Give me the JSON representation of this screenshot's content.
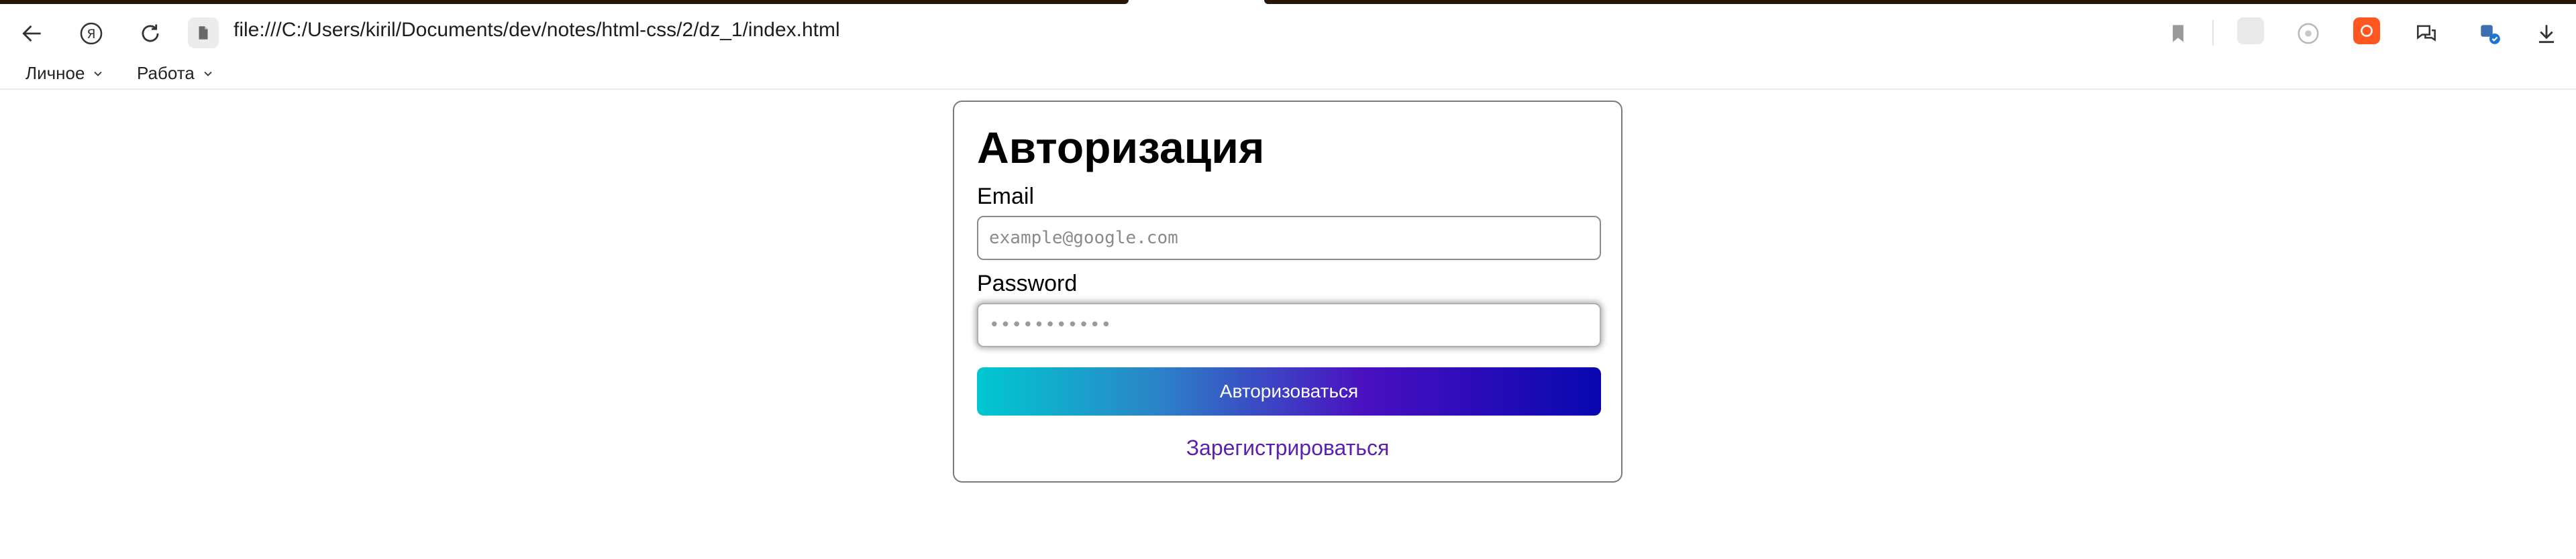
{
  "browser": {
    "url": "file:///C:/Users/kiril/Documents/dev/notes/html-css/2/dz_1/index.html",
    "bookmarks": [
      {
        "label": "Личное"
      },
      {
        "label": "Работа"
      }
    ],
    "accent_color": "#ff5722"
  },
  "form": {
    "title": "Авторизация",
    "email_label": "Email",
    "email_placeholder": "example@google.com",
    "password_label": "Password",
    "password_placeholder": "•••••••••••",
    "submit_label": "Авторизоваться",
    "register_link": "Зарегистрироваться",
    "gradient_colors": [
      "#00c8d0",
      "#4a10c0",
      "#0808b0"
    ],
    "link_color": "#5a1fb0"
  }
}
